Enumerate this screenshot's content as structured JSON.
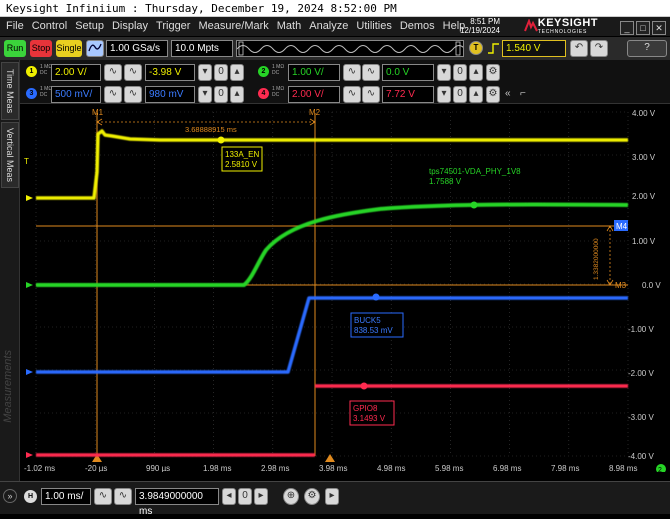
{
  "titlebar": {
    "text": "Keysight Infiniium : Thursday, December 19, 2024 8:52:00 PM"
  },
  "menu": [
    "File",
    "Control",
    "Setup",
    "Display",
    "Trigger",
    "Measure/Mark",
    "Math",
    "Analyze",
    "Utilities",
    "Demos",
    "Help"
  ],
  "clock": {
    "time": "8:51 PM",
    "date": "12/19/2024"
  },
  "brand": {
    "name": "KEYSIGHT",
    "sub": "TECHNOLOGIES"
  },
  "toolbar": {
    "run": "Run",
    "stop": "Stop",
    "single": "Single",
    "sample_rate": "1.00 GSa/s",
    "memory": "10.0 Mpts",
    "trigger_level": "1.540 V",
    "trigger_badge": "T"
  },
  "channels": [
    {
      "num": "1",
      "impedance": "1 MΩ",
      "coupling": "DC",
      "scale": "2.00 V/",
      "offset": "-3.98 V",
      "color": "#f0f000"
    },
    {
      "num": "2",
      "impedance": "1 MΩ",
      "coupling": "DC",
      "scale": "1.00 V/",
      "offset": "0.0 V",
      "color": "#26d426"
    },
    {
      "num": "3",
      "impedance": "1 MΩ",
      "coupling": "DC",
      "scale": "500 mV/",
      "offset": "980 mV",
      "color": "#2a6bff"
    },
    {
      "num": "4",
      "impedance": "1 MΩ",
      "coupling": "DC",
      "scale": "2.00 V/",
      "offset": "7.72 V",
      "color": "#ff2b50"
    }
  ],
  "sidetabs": {
    "time_meas": "Time Meas",
    "vertical_meas": "Vertical Meas",
    "measurements": "Measurements"
  },
  "graticule": {
    "y_labels": [
      "4.00 V",
      "3.00 V",
      "2.00 V",
      "1.00 V",
      "0.0 V",
      "-1.00 V",
      "-2.00 V",
      "-3.00 V",
      "-4.00 V"
    ],
    "x_labels": [
      "-1.02 ms",
      "-20 µs",
      "990 µs",
      "1.98 ms",
      "2.98 ms",
      "3.98 ms",
      "4.98 ms",
      "5.98 ms",
      "6.98 ms",
      "7.98 ms",
      "8.98 ms"
    ]
  },
  "markers": {
    "m1": "M1",
    "m2": "M2",
    "m3": "M3",
    "m4": "M4",
    "dt": "3.68888915 ms",
    "dv": "1.3382000000",
    "ch_badge": "2"
  },
  "labels": {
    "ch1_name": "133A_EN",
    "ch1_val": "2.5810 V",
    "ch2_name": "tps74501-VDA_PHY_1V8",
    "ch2_val": "1.7588 V",
    "ch3_name": "BUCK5",
    "ch3_val": "838.53 mV",
    "ch4_name": "GPIO8",
    "ch4_val": "3.1493 V"
  },
  "bottom": {
    "h_badge": "H",
    "timebase": "1.00 ms/",
    "position": "3.9849000000 ms"
  },
  "colors": {
    "cursor": "#e08a1e",
    "grid": "#404040"
  }
}
